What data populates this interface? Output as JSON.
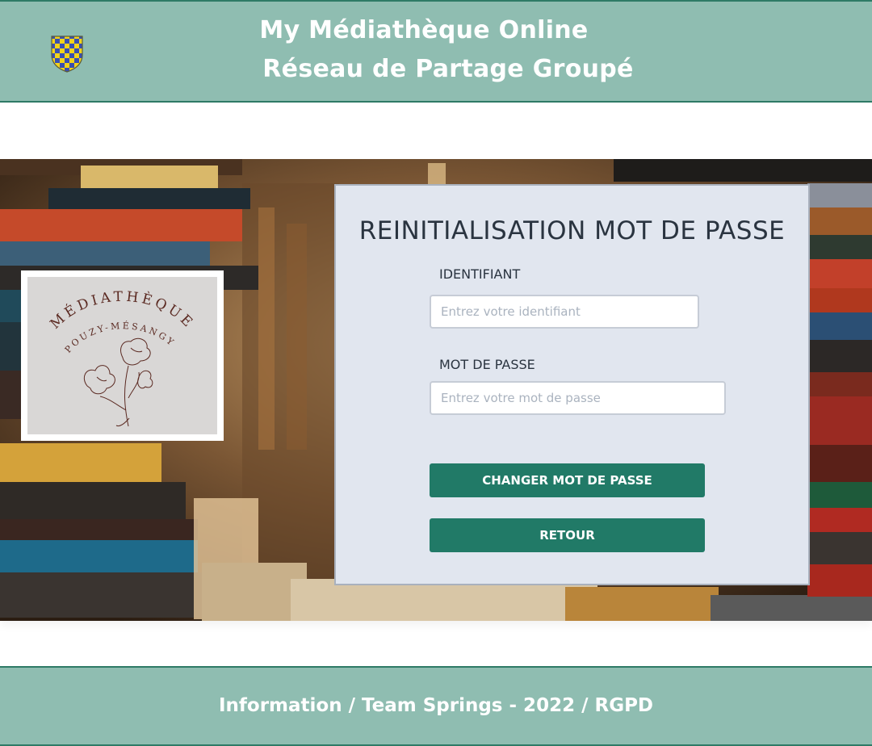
{
  "header": {
    "title_line1": "My Médiathèque Online",
    "title_line2": "Réseau de Partage Groupé"
  },
  "logo": {
    "text_top": "MÉDIATHÈQUE",
    "text_bottom": "POUZY-MÉSANGY"
  },
  "form": {
    "title": "REINITIALISATION MOT DE PASSE",
    "id_label": "IDENTIFIANT",
    "id_placeholder": "Entrez votre identifiant",
    "id_value": "",
    "password_label": "MOT DE PASSE",
    "password_placeholder": "Entrez votre mot de passe",
    "password_value": "",
    "change_button": "CHANGER MOT DE PASSE",
    "back_button": "RETOUR"
  },
  "footer": {
    "text": "Information / Team Springs - 2022 / RGPD"
  },
  "colors": {
    "header_bg": "#8fbdb1",
    "accent_border": "#2e7a66",
    "button_bg": "#217a67",
    "panel_bg": "#e1e6ef"
  },
  "icons": {
    "crest": "heraldic-shield-icon",
    "logo_flower": "flower-illustration"
  }
}
